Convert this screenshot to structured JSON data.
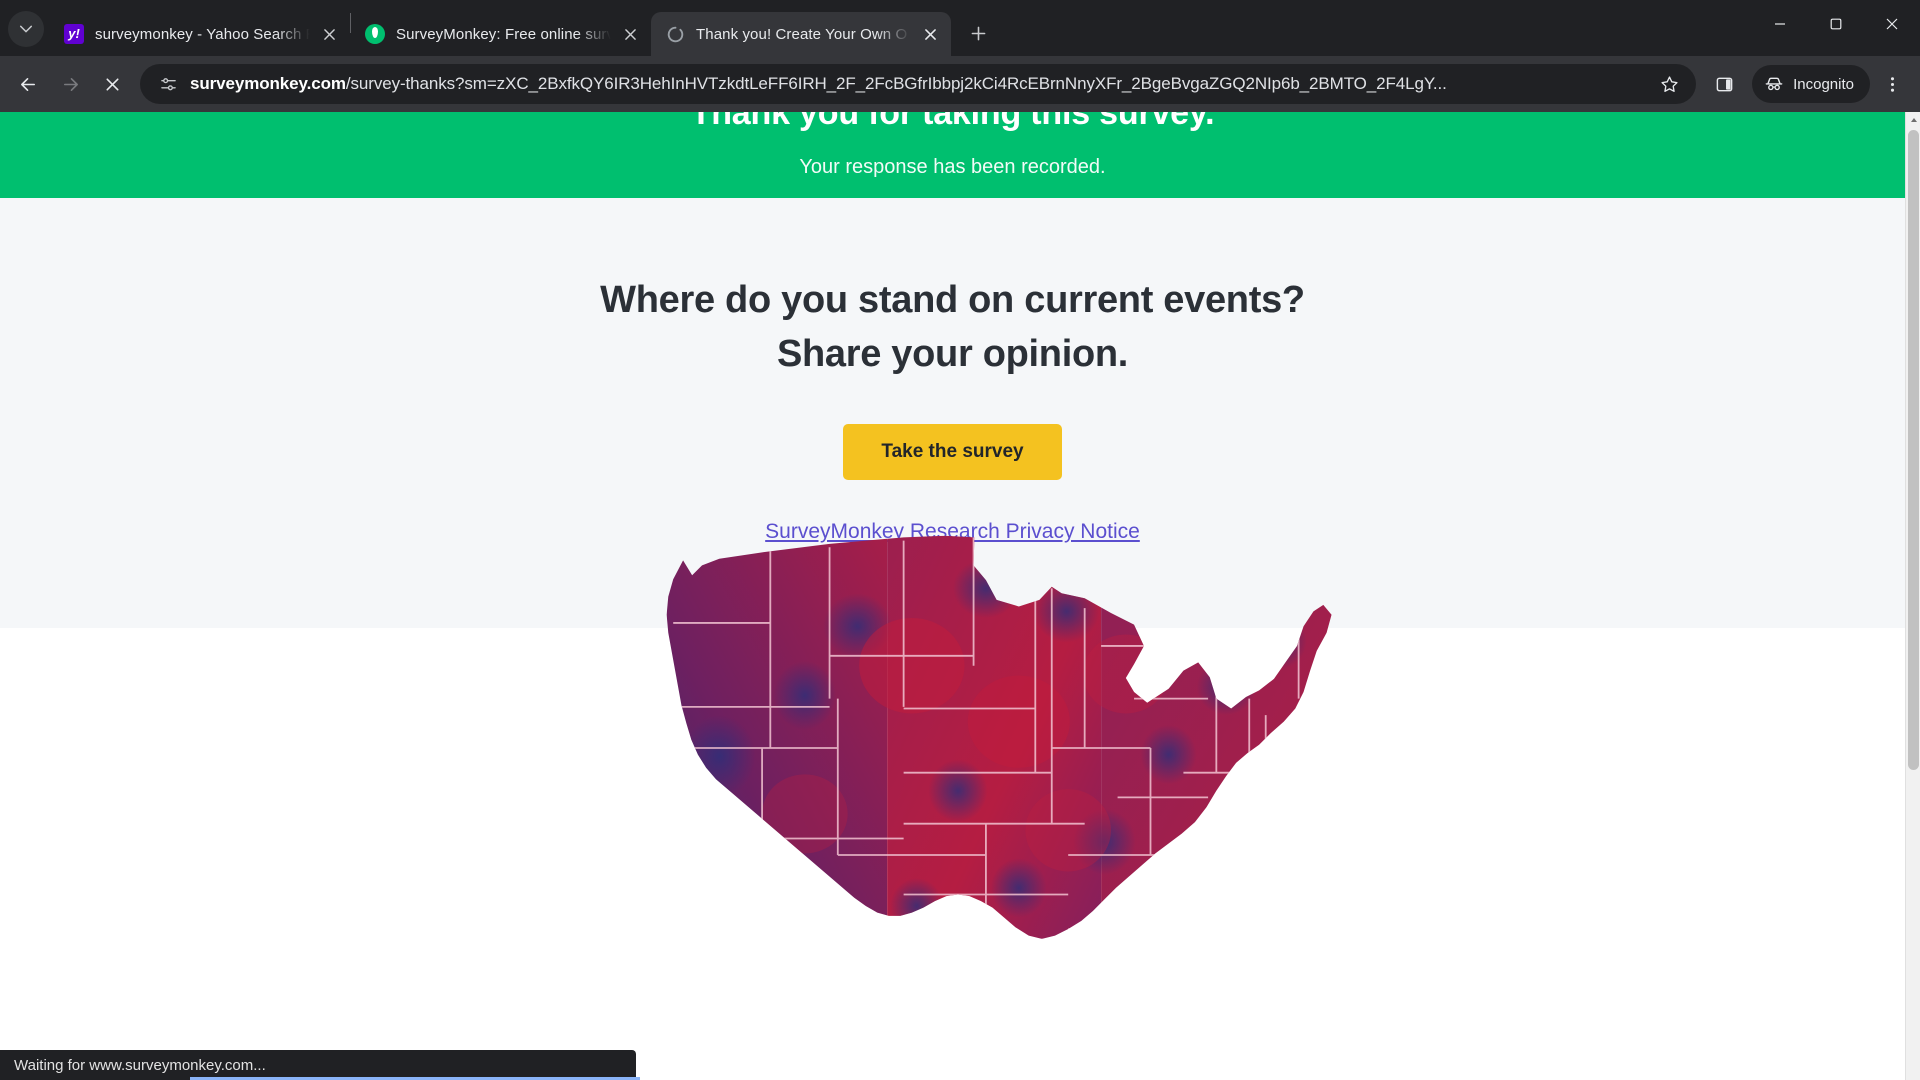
{
  "browser": {
    "tab_search_icon": "chevron-down-icon",
    "new_tab_label": "+",
    "tabs": [
      {
        "title": "surveymonkey - Yahoo Search R",
        "favicon": "yahoo-icon",
        "active": false,
        "close_label": "×"
      },
      {
        "title": "SurveyMonkey: Free online surv",
        "favicon": "surveymonkey-icon",
        "active": false,
        "close_label": "×"
      },
      {
        "title": "Thank you! Create Your Own O",
        "favicon": "loading-spinner-icon",
        "active": true,
        "close_label": "×"
      }
    ],
    "window_controls": {
      "minimize": "–",
      "maximize": "□",
      "close": "×"
    },
    "toolbar": {
      "back_label": "Back",
      "forward_label": "Forward",
      "stop_label": "Stop loading",
      "site_info_label": "View site information",
      "url_host": "surveymonkey.com",
      "url_path": "/survey-thanks?sm=zXC_2BxfkQY6IR3HehInHVTzkdtLeFF6IRH_2F_2FcBGfrIbbpj2kCi4RcEBrnNnyXFr_2BgeBvgaZGQ2NIp6b_2BMTO_2F4LgY...",
      "bookmark_label": "Bookmark this tab",
      "side_panel_label": "Side panel",
      "incognito_label": "Incognito",
      "menu_label": "Customize and control Google Chrome"
    }
  },
  "page": {
    "banner": {
      "headline": "Thank you for taking this survey.",
      "subline": "Your response has been recorded."
    },
    "promo": {
      "heading_line1": "Where do you stand on current events?",
      "heading_line2": "Share your opinion.",
      "cta_label": "Take the survey",
      "privacy_link": "SurveyMonkey Research Privacy Notice",
      "map_alt": "us-map-heatmap"
    },
    "colors": {
      "banner_green": "#00bf6f",
      "cta_yellow": "#f4c220",
      "link_purple": "#5b4fcf",
      "promo_bg": "#f5f7f9",
      "heading_text": "#2b3037",
      "map_red": "#b11f47",
      "map_blue": "#2b2f7a"
    }
  },
  "status": {
    "text": "Waiting for www.surveymonkey.com..."
  }
}
